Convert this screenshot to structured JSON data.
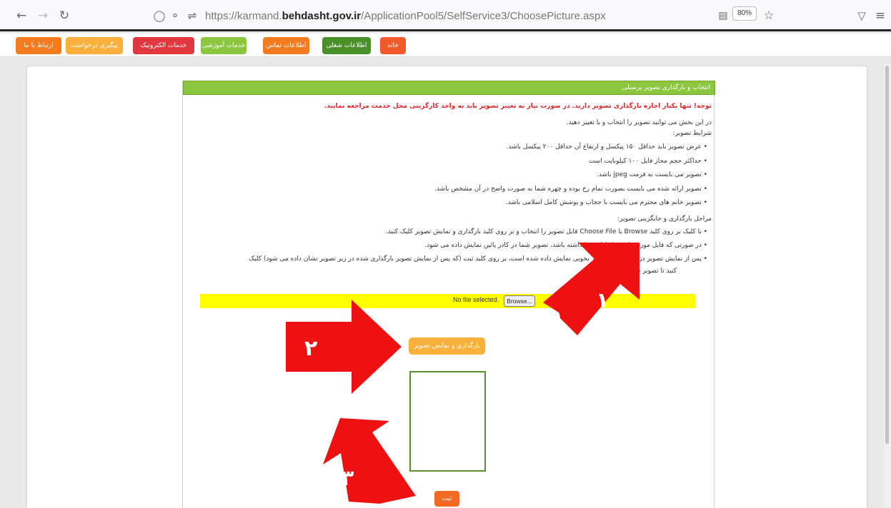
{
  "browser": {
    "url_prefix": "https://karmand.",
    "url_domain": "behdasht.gov.ir",
    "url_path": "/ApplicationPool5/SelfService3/ChoosePicture.aspx",
    "zoom": "80%"
  },
  "menu": [
    {
      "label": "ارتباط با ما",
      "color": "#f47b20"
    },
    {
      "label": "پیگیری درخواست",
      "color": "#fbb03b"
    },
    {
      "label": "خدمات الکترونیک",
      "color": "#e2373f"
    },
    {
      "label": "خدمات آموزشی",
      "color": "#8cc63f"
    },
    {
      "label": "اطلاعات تماس",
      "color": "#f47b20"
    },
    {
      "label": "اطلاعات شغلی",
      "color": "#4b8f29"
    },
    {
      "label": "خانه",
      "color": "#f05a28"
    }
  ],
  "panel": {
    "title": "انتخاب و بارگذاری تصویر پرسنلی",
    "warning": "توجه! تنها یکبار اجازه بارگذاری تصویر دارید. در صورت نیاز به تغییر تصویر باید به واحد کارگزینی محل خدمت مراجعه نمایید.",
    "intro": "در این بخش می توانید تصویر را انتخاب و یا تغییر دهید.",
    "conditions_title": "شرایط تصویر:",
    "conditions": [
      "• عرض تصویر باید حداقل ۱۵۰ پیکسل و ارتفاع آن حداقل ۲۰۰ پیکسل باشد.",
      "• حداکثر حجم مجاز فایل ۱۰۰ کیلوبایت است",
      "• تصویر می بایست به فرمت jpeg باشد.",
      "• تصویر ارائه شده می بایست بصورت تمام رخ بوده و چهره شما به صورت واضح در آن مشخص باشد.",
      "• تصویر خانم های محترم می بایست با حجاب و پوشش کامل اسلامی باشد."
    ],
    "steps_title": "مراحل بارگذاری و جایگزینی تصویر:",
    "steps": [
      "• با کلیک بر روی کلید Browse یا Choose File فایل تصویر را انتخاب و بر روی کلید بارگذاری و نمایش تصویر کلیک کنید.",
      "• در صورتی که فایل مورد نظر شرایط لازم را داشته باشد، تصویر شما در کادر پائین نمایش داده می شود.",
      "• پس از نمایش تصویر در صورتی که تصویر بخوبی نمایش داده شده است، بر روی کلید ثبت (که پس از نمایش تصویر بارگذاری شده در زیر تصویر نشان داده می شود) کلیک",
      "کنید تا تصویر شما ثبت شود."
    ]
  },
  "upload": {
    "no_file": "No file selected.",
    "browse": "Browse..."
  },
  "buttons": {
    "show": "بارگذاری و نمایش تصویر",
    "submit": "ثبت"
  },
  "annotations": [
    "۱",
    "۲",
    "۳"
  ]
}
